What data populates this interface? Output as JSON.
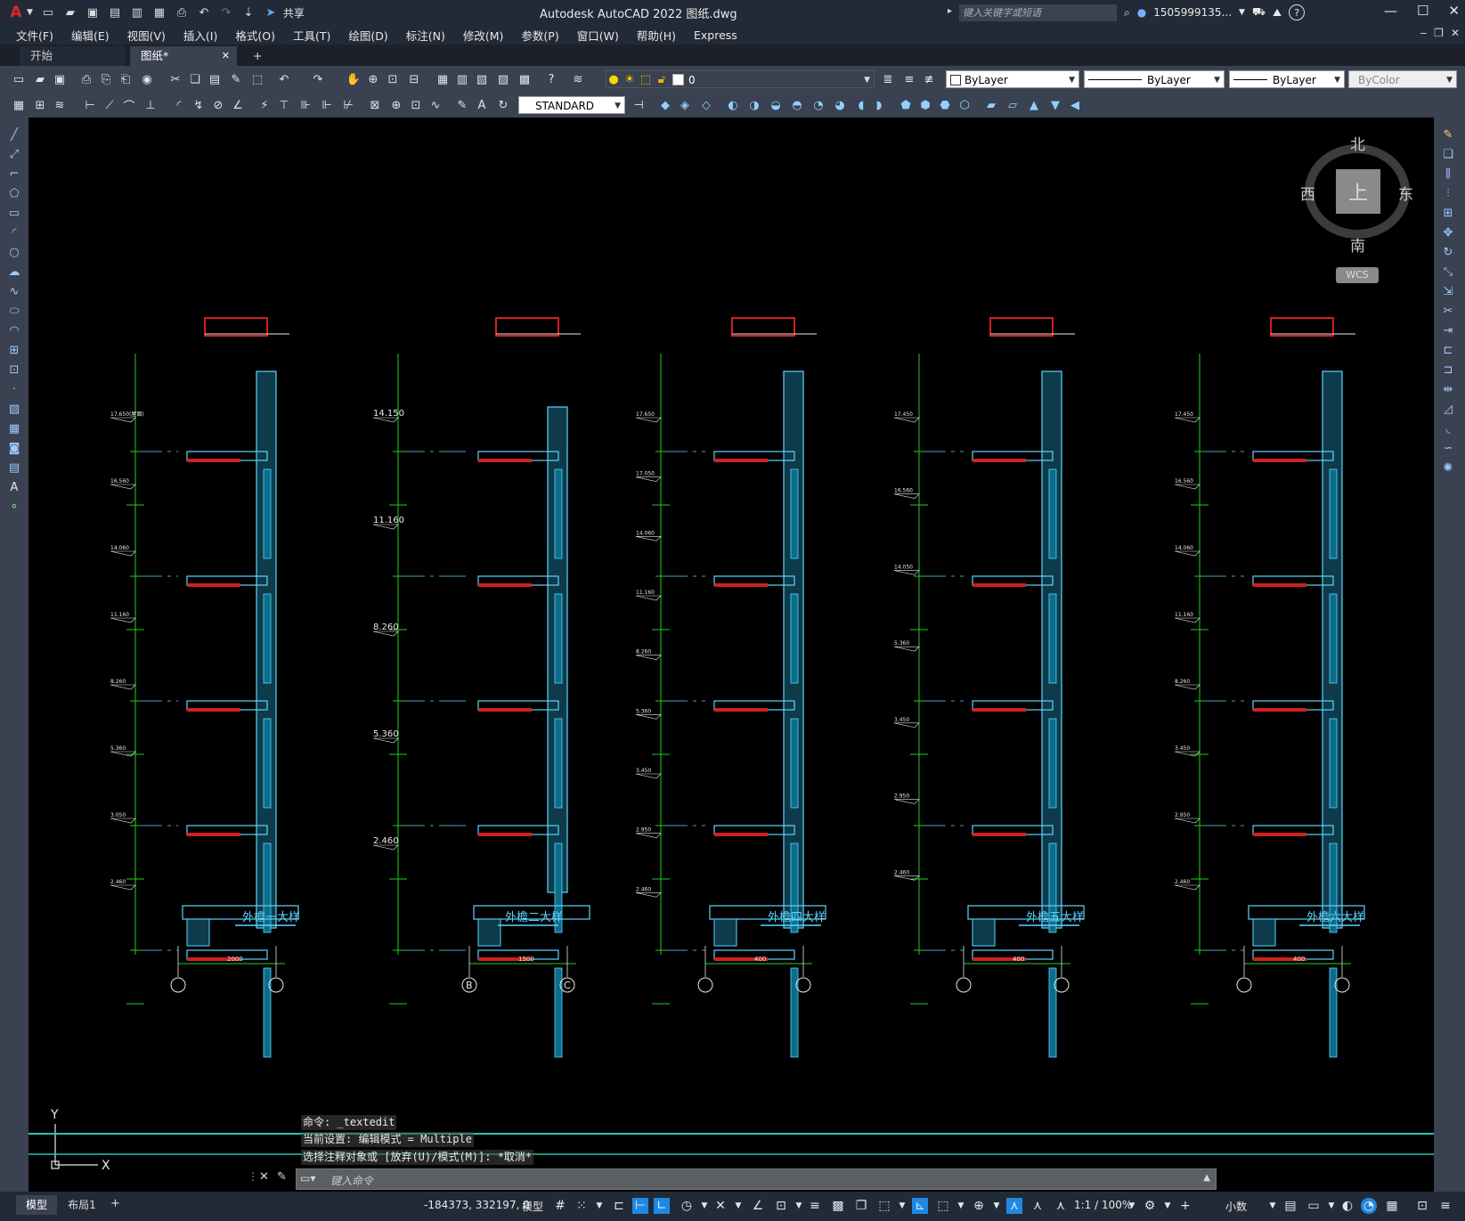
{
  "app": {
    "logo": "A",
    "title": "Autodesk AutoCAD 2022    图纸.dwg",
    "share_label": "共享",
    "search_placeholder": "键入关键字或短语",
    "user": "1505999135...",
    "colors": {
      "titlebar": "#232a37",
      "toolbar": "#3a4150",
      "canvas": "#000000",
      "accent": "#1e88e5"
    }
  },
  "menu": [
    "文件(F)",
    "编辑(E)",
    "视图(V)",
    "插入(I)",
    "格式(O)",
    "工具(T)",
    "绘图(D)",
    "标注(N)",
    "修改(M)",
    "参数(P)",
    "窗口(W)",
    "帮助(H)",
    "Express"
  ],
  "tabs": {
    "start": "开始",
    "drawing": "图纸*",
    "close": "✕",
    "add": "+"
  },
  "toolbar": {
    "layer_name": "0",
    "color": "ByLayer",
    "linetype": "ByLayer",
    "lineweight": "ByLayer",
    "plotstyle": "ByColor",
    "text_style": "STANDARD"
  },
  "viewcube": {
    "north": "北",
    "south": "南",
    "east": "东",
    "west": "西",
    "face": "上",
    "wcs": "WCS"
  },
  "drawing": {
    "details": [
      {
        "title": "外檐一大样",
        "axes": [
          "",
          ""
        ],
        "dims": [
          "2000"
        ],
        "levels": [
          "17.650(屋面)",
          "16.560",
          "14.060",
          "11.160",
          "8.260",
          "5.360",
          "3.050",
          "2.460"
        ]
      },
      {
        "title": "外檐二大样",
        "axes": [
          "B",
          "C"
        ],
        "dims": [
          "1500"
        ],
        "levels": [
          "14.150",
          "11.160",
          "8.260",
          "5.360",
          "2.460"
        ]
      },
      {
        "title": "外檐四大样",
        "axes": [
          "",
          ""
        ],
        "dims": [
          "400"
        ],
        "levels": [
          "17.650",
          "17.050",
          "14.060",
          "11.160",
          "8.260",
          "5.360",
          "3.450",
          "2.950",
          "2.460"
        ]
      },
      {
        "title": "外檐五大样",
        "axes": [
          "",
          ""
        ],
        "dims": [
          "400"
        ],
        "levels": [
          "17.450",
          "16.560",
          "14.050",
          "5.360",
          "3.450",
          "2.950",
          "2.460"
        ]
      },
      {
        "title": "外檐六大样",
        "axes": [
          "",
          ""
        ],
        "dims": [
          "400"
        ],
        "levels": [
          "17.450",
          "16.560",
          "14.060",
          "11.160",
          "8.260",
          "3.450",
          "2.950",
          "2.460"
        ]
      }
    ],
    "ucs": {
      "x": "X",
      "y": "Y"
    }
  },
  "command": {
    "history": [
      "命令: _textedit",
      "当前设置: 编辑模式 = Multiple",
      "选择注释对象或 [放弃(U)/模式(M)]: *取消*"
    ],
    "placeholder": "键入命令"
  },
  "status": {
    "tabs": [
      "模型",
      "布局1"
    ],
    "coords": "-184373, 332197, 0",
    "space": "模型",
    "scale": "1:1 / 100%",
    "units": "小数"
  }
}
